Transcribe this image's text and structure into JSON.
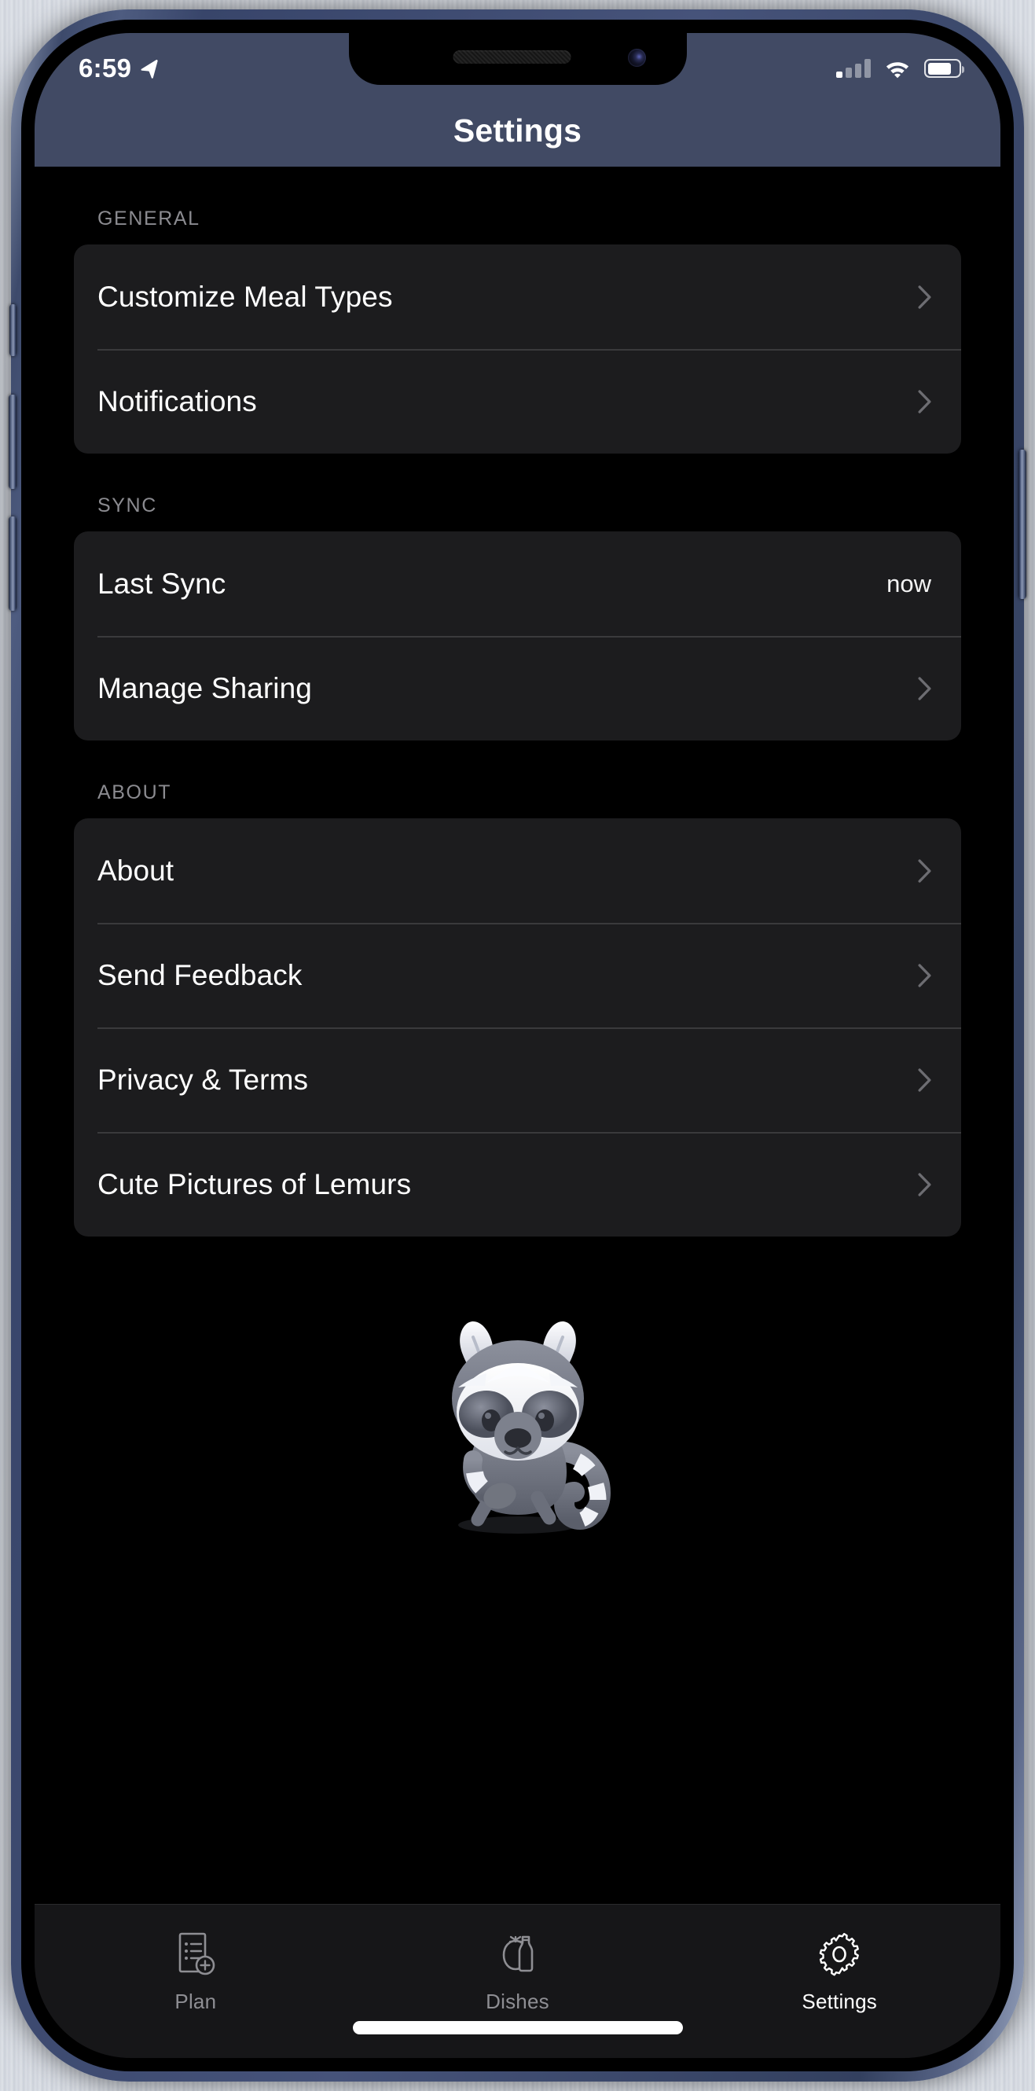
{
  "device": {
    "frame_color": "#46537a",
    "screen_background": "#000000"
  },
  "status_bar": {
    "time": "6:59",
    "location_icon": "location-arrow-icon",
    "cellular_icon": "cellular-signal-icon",
    "cellular_bars_filled": 1,
    "cellular_bars_total": 4,
    "wifi_icon": "wifi-icon",
    "battery_icon": "battery-icon",
    "battery_level_percent": 78
  },
  "header": {
    "title": "Settings",
    "background_color": "#414a64",
    "title_color": "#ffffff"
  },
  "sections": [
    {
      "title": "GENERAL",
      "rows": [
        {
          "label": "Customize Meal Types",
          "value": "",
          "accessory": "chevron-right-icon"
        },
        {
          "label": "Notifications",
          "value": "",
          "accessory": "chevron-right-icon"
        }
      ]
    },
    {
      "title": "SYNC",
      "rows": [
        {
          "label": "Last Sync",
          "value": "now",
          "accessory": "none"
        },
        {
          "label": "Manage Sharing",
          "value": "",
          "accessory": "chevron-right-icon"
        }
      ]
    },
    {
      "title": "ABOUT",
      "rows": [
        {
          "label": "About",
          "value": "",
          "accessory": "chevron-right-icon"
        },
        {
          "label": "Send Feedback",
          "value": "",
          "accessory": "chevron-right-icon"
        },
        {
          "label": "Privacy & Terms",
          "value": "",
          "accessory": "chevron-right-icon"
        },
        {
          "label": "Cute Pictures of Lemurs",
          "value": "",
          "accessory": "chevron-right-icon"
        }
      ]
    }
  ],
  "mascot": {
    "name": "lemur-mascot-illustration",
    "primary_color": "#6e7280",
    "fur_color": "#f2f3f7"
  },
  "tab_bar": {
    "background_color": "#161618",
    "inactive_color": "#8e8e93",
    "active_color": "#ffffff",
    "tabs": [
      {
        "label": "Plan",
        "icon": "document-list-plus-icon",
        "active": false
      },
      {
        "label": "Dishes",
        "icon": "tomato-bottle-icon",
        "active": false
      },
      {
        "label": "Settings",
        "icon": "gear-icon",
        "active": true
      }
    ]
  },
  "home_indicator": {
    "visible": true
  }
}
